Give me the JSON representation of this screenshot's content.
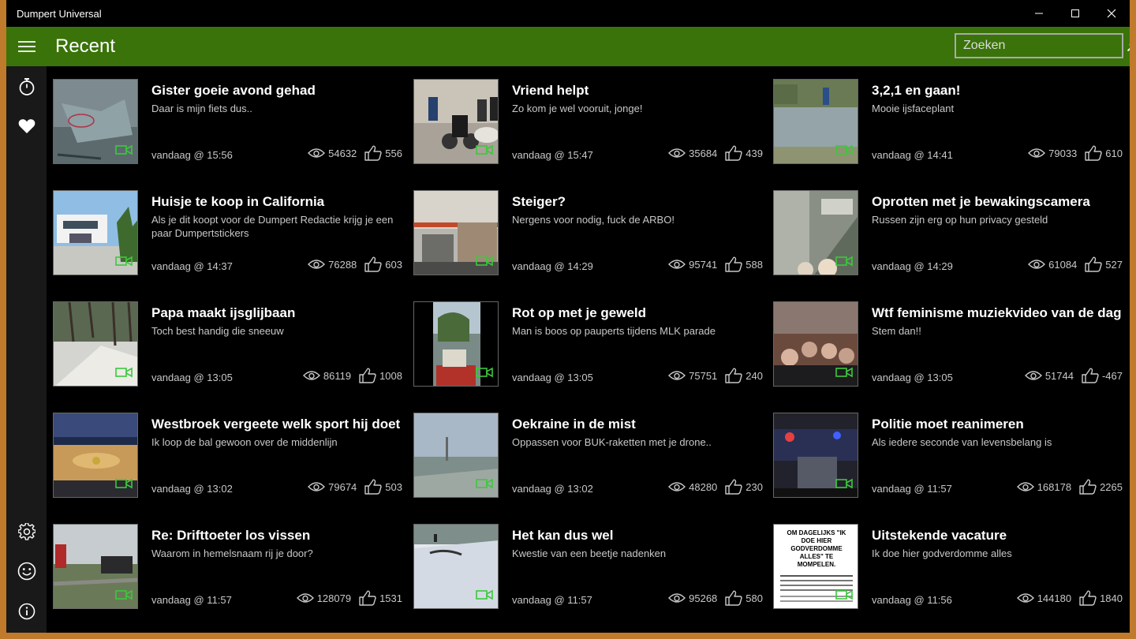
{
  "window": {
    "title": "Dumpert Universal"
  },
  "header": {
    "title": "Recent"
  },
  "search": {
    "placeholder": "Zoeken"
  },
  "sidebar": {
    "top": [
      "stopwatch-icon",
      "heart-icon"
    ],
    "bottom": [
      "gear-icon",
      "smiley-icon",
      "info-icon"
    ]
  },
  "colors": {
    "accent": "#3a7309",
    "frame": "#c07a2c",
    "camera": "#3cc83c"
  },
  "items": [
    {
      "title": "Gister goeie avond gehad",
      "subtitle": "Daar is mijn fiets dus..",
      "date": "vandaag @ 15:56",
      "views": "54632",
      "kudos": "556"
    },
    {
      "title": "Vriend helpt",
      "subtitle": "Zo kom je wel vooruit, jonge!",
      "date": "vandaag @ 15:47",
      "views": "35684",
      "kudos": "439"
    },
    {
      "title": "3,2,1 en gaan!",
      "subtitle": "Mooie ijsfaceplant",
      "date": "vandaag @ 14:41",
      "views": "79033",
      "kudos": "610"
    },
    {
      "title": "Huisje te koop in California",
      "subtitle": "Als je dit koopt voor de Dumpert Redactie krijg je een paar Dumpertstickers",
      "date": "vandaag @ 14:37",
      "views": "76288",
      "kudos": "603"
    },
    {
      "title": "Steiger?",
      "subtitle": "Nergens voor nodig, fuck de ARBO!",
      "date": "vandaag @ 14:29",
      "views": "95741",
      "kudos": "588"
    },
    {
      "title": "Oprotten met je bewakingscamera",
      "subtitle": "Russen zijn erg op hun privacy gesteld",
      "date": "vandaag @ 14:29",
      "views": "61084",
      "kudos": "527"
    },
    {
      "title": "Papa maakt ijsglijbaan",
      "subtitle": "Toch best handig die sneeuw",
      "date": "vandaag @ 13:05",
      "views": "86119",
      "kudos": "1008"
    },
    {
      "title": "Rot op met je geweld",
      "subtitle": "Man is boos op pauperts tijdens MLK parade",
      "date": "vandaag @ 13:05",
      "views": "75751",
      "kudos": "240"
    },
    {
      "title": "Wtf feminisme muziekvideo van de dag",
      "subtitle": "Stem dan!!",
      "date": "vandaag @ 13:05",
      "views": "51744",
      "kudos": "-467"
    },
    {
      "title": "Westbroek vergeete welk sport hij doet",
      "subtitle": "Ik loop de bal gewoon over de middenlijn",
      "date": "vandaag @ 13:02",
      "views": "79674",
      "kudos": "503"
    },
    {
      "title": "Oekraine in de mist",
      "subtitle": "Oppassen voor BUK-raketten met je drone..",
      "date": "vandaag @ 13:02",
      "views": "48280",
      "kudos": "230"
    },
    {
      "title": "Politie moet reanimeren",
      "subtitle": "Als iedere seconde van levensbelang is",
      "date": "vandaag @ 11:57",
      "views": "168178",
      "kudos": "2265"
    },
    {
      "title": "Re: Drifttoeter los vissen",
      "subtitle": "Waarom in hemelsnaam rij je door?",
      "date": "vandaag @ 11:57",
      "views": "128079",
      "kudos": "1531"
    },
    {
      "title": "Het kan dus wel",
      "subtitle": "Kwestie van een beetje nadenken",
      "date": "vandaag @ 11:57",
      "views": "95268",
      "kudos": "580"
    },
    {
      "title": "Uitstekende vacature",
      "subtitle": "Ik doe hier godverdomme alles",
      "date": "vandaag @ 11:56",
      "views": "144180",
      "kudos": "1840",
      "thumb_text": "OM DAGELIJKS \"IK DOE HIER GODVERDOMME ALLES\" TE MOMPELEN."
    }
  ]
}
